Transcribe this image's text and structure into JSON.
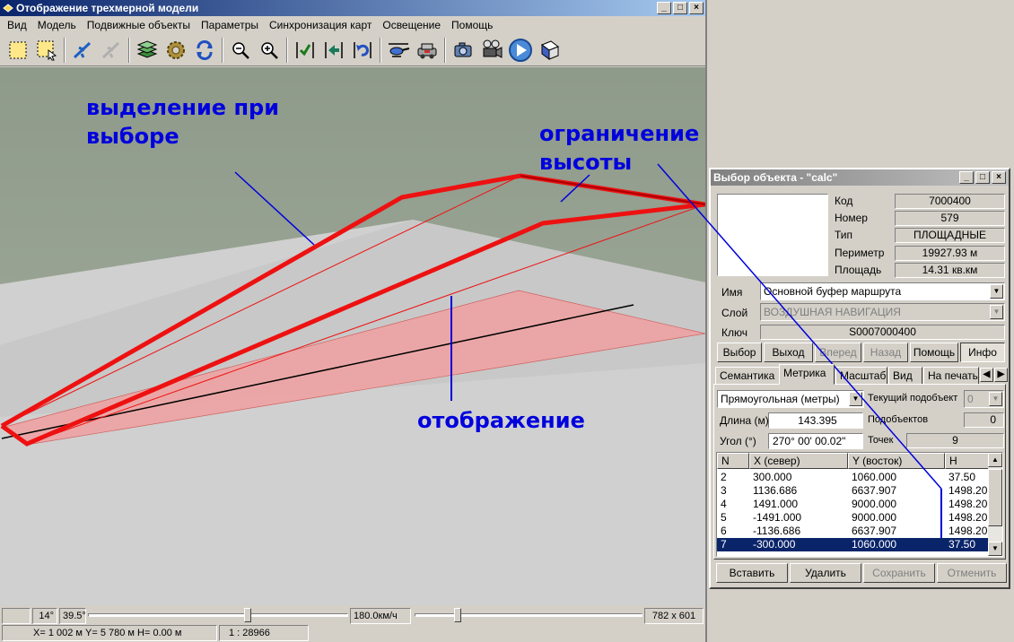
{
  "window": {
    "title": "Отображение трехмерной модели"
  },
  "menu": [
    "Вид",
    "Модель",
    "Подвижные объекты",
    "Параметры",
    "Синхронизация карт",
    "Освещение",
    "Помощь"
  ],
  "toolbar_icons": [
    "select-rect-icon",
    "select-object-icon",
    "plane-icon",
    "plane-ghost-icon",
    "layers-icon",
    "gear-icon",
    "refresh-icon",
    "zoom-out-icon",
    "zoom-in-icon",
    "check-icon",
    "move-left-icon",
    "undo-icon",
    "helicopter-icon",
    "vehicle-icon",
    "camera-icon",
    "film-camera-icon",
    "play-icon",
    "book-icon"
  ],
  "annotations": {
    "selection": [
      "выделение при",
      "выборе"
    ],
    "height_limit": [
      "ограничение",
      "высоты"
    ],
    "display": "отображение"
  },
  "status": {
    "angle1": "14°",
    "angle2": "39.5°",
    "speed": "180.0км/ч",
    "resolution": "782 x 601",
    "coords": "X= 1 002 м  Y= 5 780 м  H= 0.00 м",
    "scale": "1 : 28966"
  },
  "dialog": {
    "title": "Выбор объекта - \"calc\"",
    "info": {
      "code_label": "Код",
      "code": "7000400",
      "number_label": "Номер",
      "number": "579",
      "type_label": "Тип",
      "type": "ПЛОЩАДНЫЕ",
      "perimeter_label": "Периметр",
      "perimeter": "19927.93  м",
      "area_label": "Площадь",
      "area": "14.31  кв.км"
    },
    "name_label": "Имя",
    "name": "Основной буфер маршрута",
    "layer_label": "Слой",
    "layer": "ВОЗДУШНАЯ НАВИГАЦИЯ",
    "key_label": "Ключ",
    "key": "S0007000400",
    "buttons": {
      "select": "Выбор",
      "exit": "Выход",
      "forward": "Вперед",
      "back": "Назад",
      "help": "Помощь",
      "info": "Инфо"
    },
    "tabs": [
      "Семантика",
      "Метрика",
      "Масштаб",
      "Вид",
      "На печать"
    ],
    "metric": {
      "coord_system": "Прямоугольная (метры)",
      "current_sub_label": "Текущий подобъект",
      "current_sub": "0",
      "length_label": "Длина (м)",
      "length": "143.395",
      "subobjects_label": "Подобъектов",
      "subobjects": "0",
      "angle_label": "Угол (°)",
      "angle": "270° 00' 00.02\"",
      "points_label": "Точек",
      "points": "9"
    },
    "table": {
      "columns": [
        "N",
        "X  (север)",
        "Y  (восток)",
        "H"
      ],
      "rows": [
        [
          "2",
          "300.000",
          "1060.000",
          "37.50"
        ],
        [
          "3",
          "1136.686",
          "6637.907",
          "1498.20"
        ],
        [
          "4",
          "1491.000",
          "9000.000",
          "1498.20"
        ],
        [
          "5",
          "-1491.000",
          "9000.000",
          "1498.20"
        ],
        [
          "6",
          "-1136.686",
          "6637.907",
          "1498.20"
        ],
        [
          "7",
          "-300.000",
          "1060.000",
          "37.50"
        ]
      ],
      "selected_row": 5
    },
    "bottom_buttons": {
      "insert": "Вставить",
      "delete": "Удалить",
      "save": "Сохранить",
      "cancel": "Отменить"
    }
  },
  "colors": {
    "titlebar": "#0a246a",
    "annotation": "#0000dd",
    "route": "#ee1111",
    "zone": "#f0a0a0"
  }
}
